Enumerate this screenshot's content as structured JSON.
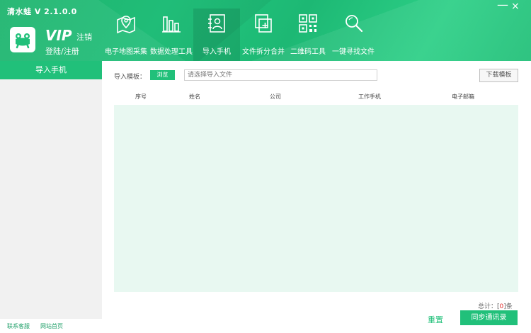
{
  "window": {
    "title": "清水蛙 V 2.1.0.0",
    "minimize_symbol": "—",
    "close_symbol": "×"
  },
  "account": {
    "vip_label": "VIP",
    "logout_label": "注销",
    "login_label": "登陆/注册"
  },
  "toolbar": {
    "items": [
      {
        "label": "电子地图采集",
        "icon": "map-pin-icon"
      },
      {
        "label": "数据处理工具",
        "icon": "bar-chart-icon"
      },
      {
        "label": "导入手机",
        "icon": "contact-card-icon"
      },
      {
        "label": "文件拆分合并",
        "icon": "file-split-icon"
      },
      {
        "label": "二维码工具",
        "icon": "qr-code-icon"
      },
      {
        "label": "一键寻找文件",
        "icon": "search-icon"
      }
    ],
    "active_index": 2
  },
  "sidebar": {
    "active_item": "导入手机"
  },
  "import_form": {
    "template_label": "导入模板：",
    "browse_label": "浏览",
    "file_placeholder": "请选择导入文件",
    "download_label": "下载模板"
  },
  "table": {
    "columns": [
      "序号",
      "姓名",
      "公司",
      "工作手机",
      "电子邮箱"
    ],
    "rows": []
  },
  "summary": {
    "prefix": "总计：[",
    "count": "0",
    "suffix": "]条"
  },
  "actions": {
    "reset_label": "重置",
    "sync_label": "同步通讯录"
  },
  "footer": {
    "support_label": "联系客服",
    "homepage_label": "网站首页"
  },
  "colors": {
    "accent": "#21c07a",
    "table_bg": "#e8f8f1",
    "sidebar_bg": "#f1f1f1"
  }
}
